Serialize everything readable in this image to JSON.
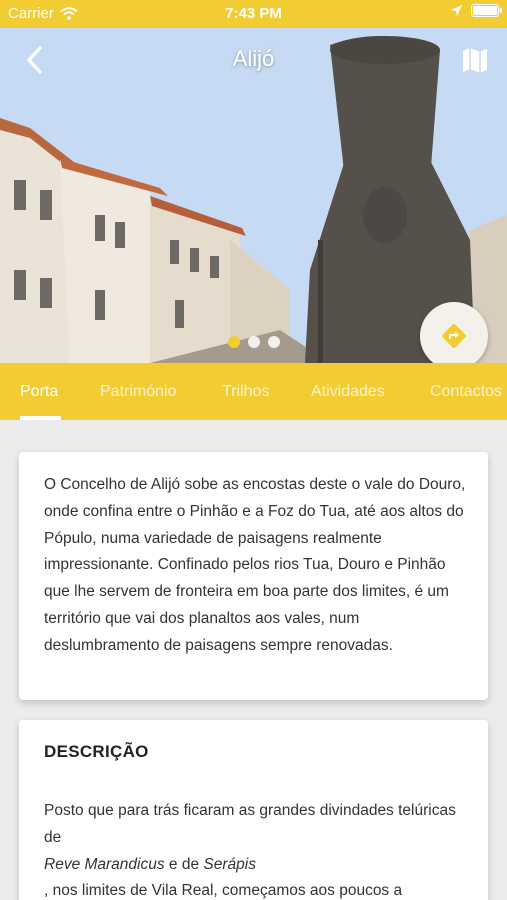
{
  "status_bar": {
    "carrier": "Carrier",
    "time": "7:43 PM",
    "battery_level": 1.0
  },
  "header": {
    "title": "Alijó",
    "back_icon": "chevron-left-icon",
    "map_icon": "map-icon"
  },
  "hero": {
    "dots_total": 3,
    "dots_active_index": 0,
    "fab_icon": "directions-icon"
  },
  "tabs": [
    {
      "label": "Porta",
      "active": true
    },
    {
      "label": "Património",
      "active": false
    },
    {
      "label": "Trilhos",
      "active": false
    },
    {
      "label": "Atividades",
      "active": false
    },
    {
      "label": "Contactos",
      "active": false
    }
  ],
  "intro": {
    "text": "O Concelho de Alijó sobe as encostas deste o vale do Douro, onde confina entre o Pinhão e a Foz do Tua, até aos altos do Pópulo, numa variedade de paisagens realmente impressionante. Confinado pelos rios Tua, Douro e Pinhão que lhe servem de fronteira em boa parte dos limites, é um território que vai dos planaltos aos vales, num deslumbramento de paisagens sempre renovadas."
  },
  "description": {
    "heading": "DESCRIÇÃO",
    "line1": "Posto que para trás ficaram as grandes divindades telúricas de",
    "italic1": "Reve Marandicus",
    "connector": " e de ",
    "italic2": "Serápis",
    "line3": ", nos limites de Vila Real, começamos aos poucos a"
  },
  "colors": {
    "accent": "#f2cc33",
    "background": "#ececec",
    "card": "#ffffff",
    "text": "#333333"
  }
}
